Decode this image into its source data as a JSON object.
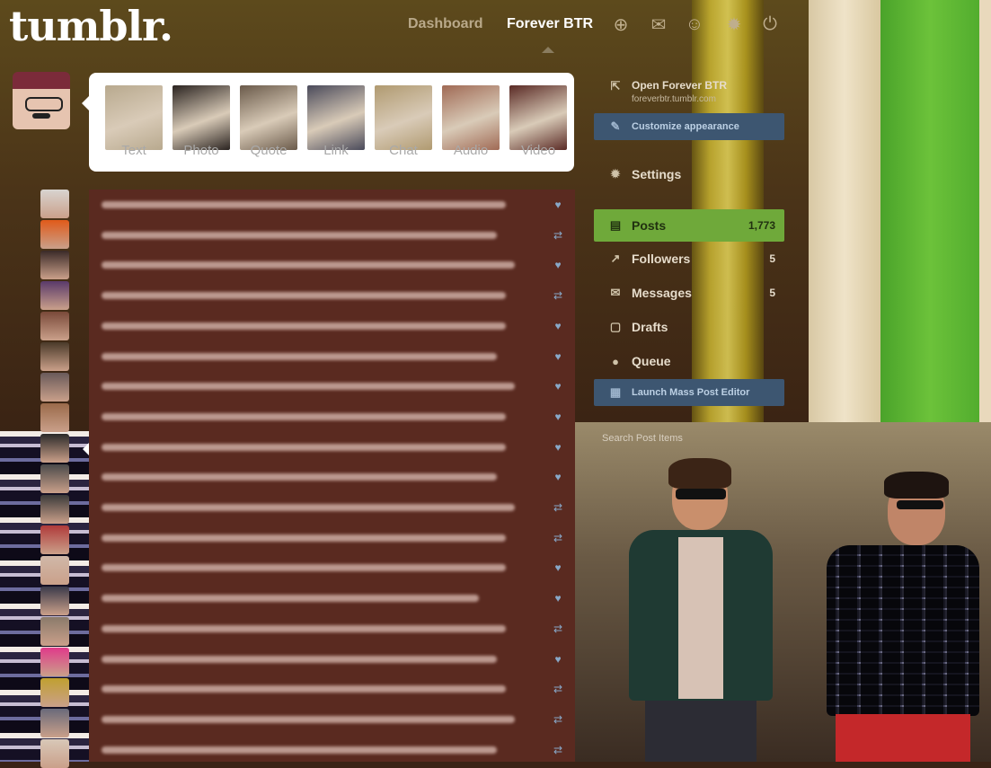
{
  "header": {
    "logo": "tumblr.",
    "nav_dashboard": "Dashboard",
    "nav_blog": "Forever BTR",
    "icons": [
      "new-post-icon",
      "mail-icon",
      "help-icon",
      "gear-icon",
      "power-icon"
    ]
  },
  "post_types": [
    {
      "label": "Text",
      "color": "#b8a98e"
    },
    {
      "label": "Photo",
      "color": "#2a2320"
    },
    {
      "label": "Quote",
      "color": "#6a5a4a"
    },
    {
      "label": "Link",
      "color": "#4a4a5a"
    },
    {
      "label": "Chat",
      "color": "#b09a70"
    },
    {
      "label": "Audio",
      "color": "#a06a55"
    },
    {
      "label": "Video",
      "color": "#5a2a25"
    }
  ],
  "sidebar": {
    "open_blog": "Open Forever BTR",
    "open_blog_sub": "foreverbtr.tumblr.com",
    "customize": "Customize appearance",
    "settings": "Settings",
    "posts": {
      "label": "Posts",
      "count": "1,773"
    },
    "followers": {
      "label": "Followers",
      "count": "5"
    },
    "messages": {
      "label": "Messages",
      "count": "5"
    },
    "drafts": "Drafts",
    "queue": "Queue",
    "mass_editor": "Launch Mass Post Editor",
    "follow_text": "Search Post Items"
  },
  "feed": {
    "rows": [
      {
        "width": 450,
        "icon": "heart",
        "avatar": "#d8d4d0"
      },
      {
        "width": 440,
        "icon": "reblog",
        "avatar": "#e05a1a"
      },
      {
        "width": 460,
        "icon": "heart",
        "avatar": "#3a2a28"
      },
      {
        "width": 450,
        "icon": "reblog",
        "avatar": "#5a3a6a"
      },
      {
        "width": 450,
        "icon": "heart",
        "avatar": "#7a4a3a"
      },
      {
        "width": 440,
        "icon": "heart",
        "avatar": "#4a3a2a"
      },
      {
        "width": 460,
        "icon": "heart",
        "avatar": "#6a5a5a"
      },
      {
        "width": 450,
        "icon": "heart",
        "avatar": "#9a6a4a"
      },
      {
        "width": 450,
        "icon": "heart",
        "avatar": "#2a2a2a"
      },
      {
        "width": 440,
        "icon": "heart",
        "avatar": "#4a4a4a"
      },
      {
        "width": 460,
        "icon": "reblog",
        "avatar": "#3a3a3a"
      },
      {
        "width": 450,
        "icon": "reblog",
        "avatar": "#b03a3a"
      },
      {
        "width": 450,
        "icon": "heart",
        "avatar": "#d0b8a8"
      },
      {
        "width": 420,
        "icon": "heart",
        "avatar": "#3a3a4a"
      },
      {
        "width": 450,
        "icon": "reblog",
        "avatar": "#8a7a6a"
      },
      {
        "width": 440,
        "icon": "heart",
        "avatar": "#e03a8a"
      },
      {
        "width": 450,
        "icon": "reblog",
        "avatar": "#c0a030"
      },
      {
        "width": 460,
        "icon": "reblog",
        "avatar": "#6a6a7a"
      },
      {
        "width": 440,
        "icon": "reblog",
        "avatar": "#d8c8b8"
      }
    ]
  },
  "colors": {
    "accent_green": "#6fa93a",
    "button_blue": "#3d5671",
    "post_bg": "#5a2a20"
  }
}
